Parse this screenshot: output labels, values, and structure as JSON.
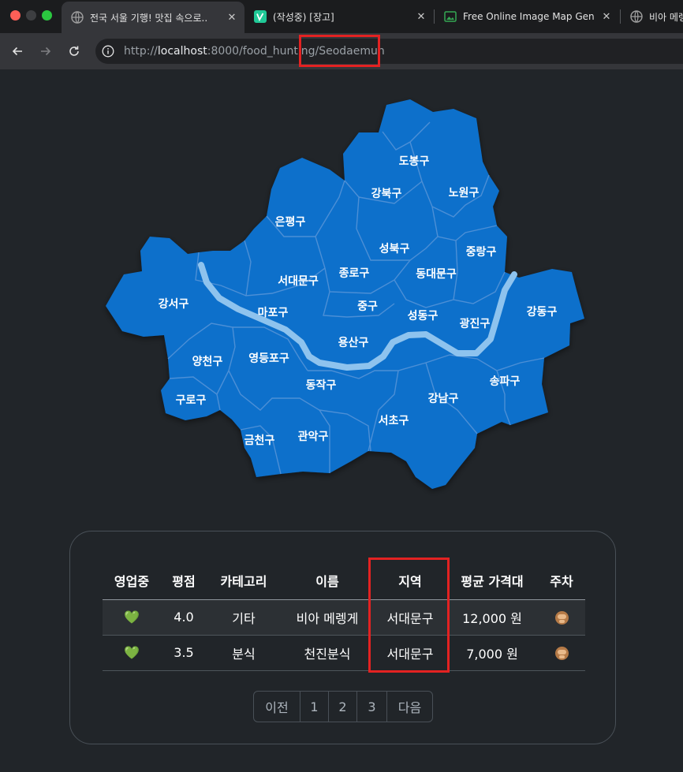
{
  "browser": {
    "tabs": [
      {
        "title": "전국 서울 기행! 맛집 속으로..",
        "active": true,
        "icon": "globe-icon"
      },
      {
        "title": "(작성중) [장고]",
        "active": false,
        "icon": "velog-icon"
      },
      {
        "title": "Free Online Image Map Generator",
        "active": false,
        "icon": "image-icon"
      },
      {
        "title": "비아 메렝게",
        "active": false,
        "icon": "globe-icon"
      }
    ],
    "close_glyph": "✕",
    "url_protocol": "http://",
    "url_host": "localhost",
    "url_path": ":8000/food_hunting/Seodaemun"
  },
  "map": {
    "districts": [
      "도봉구",
      "강북구",
      "노원구",
      "은평구",
      "성북구",
      "중랑구",
      "서대문구",
      "종로구",
      "동대문구",
      "강서구",
      "마포구",
      "중구",
      "성동구",
      "광진구",
      "강동구",
      "용산구",
      "양천구",
      "영등포구",
      "동작구",
      "송파구",
      "구로구",
      "강남구",
      "서초구",
      "금천구",
      "관악구"
    ],
    "fill_color": "#0a6fcb",
    "river_color": "#8ec3ee"
  },
  "table": {
    "headers": [
      "영업중",
      "평점",
      "카테고리",
      "이름",
      "지역",
      "평균 가격대",
      "주차"
    ],
    "rows": [
      {
        "open": "💚",
        "rating": "4.0",
        "category": "기타",
        "name": "비아 메렝게",
        "region": "서대문구",
        "price": "12,000 원",
        "parking": "monkey-icon"
      },
      {
        "open": "💚",
        "rating": "3.5",
        "category": "분식",
        "name": "천진분식",
        "region": "서대문구",
        "price": "7,000 원",
        "parking": "monkey-icon"
      }
    ]
  },
  "pagination": {
    "prev": "이전",
    "pages": [
      "1",
      "2",
      "3"
    ],
    "next": "다음"
  },
  "colors": {
    "highlight": "#e32222",
    "background": "#212529"
  }
}
